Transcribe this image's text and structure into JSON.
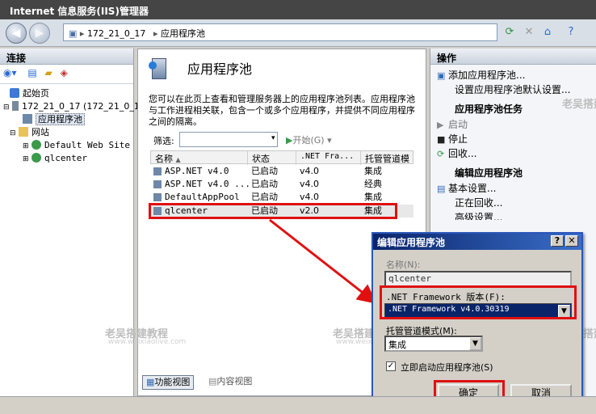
{
  "window": {
    "title": "Internet 信息服务(IIS)管理器"
  },
  "address": {
    "host": "172_21_0_17",
    "page": "应用程序池",
    "sep": "▸"
  },
  "left": {
    "header": "连接",
    "tree": {
      "start": "起始页",
      "server": "172_21_0_17 (172_21_0_1",
      "apppools": "应用程序池",
      "sites": "网站",
      "site1": "Default Web Site",
      "site2": "qlcenter"
    }
  },
  "center": {
    "title": "应用程序池",
    "description": "您可以在此页上查看和管理服务器上的应用程序池列表。应用程序池与工作进程相关联，包含一个或多个应用程序，并提供不同应用程序之间的隔离。",
    "filter_label": "筛选:",
    "start_label": "开始(G)",
    "columns": [
      "名称",
      "状态",
      ".NET Fra...",
      "托管管道模"
    ],
    "rows": [
      [
        "ASP.NET v4.0",
        "已启动",
        "v4.0",
        "集成"
      ],
      [
        "ASP.NET v4.0 ...",
        "已启动",
        "v4.0",
        "经典"
      ],
      [
        "DefaultAppPool",
        "已启动",
        "v4.0",
        "集成"
      ],
      [
        "qlcenter",
        "已启动",
        "v2.0",
        "集成"
      ]
    ],
    "tab_features": "功能视图",
    "tab_content": "内容视图"
  },
  "right": {
    "header": "操作",
    "add_pool": "添加应用程序池...",
    "set_defaults": "设置应用程序池默认设置...",
    "tasks_header": "应用程序池任务",
    "start": "启动",
    "stop": "停止",
    "recycle": "回收...",
    "edit_header": "编辑应用程序池",
    "basic": "基本设置...",
    "recycling": "正在回收...",
    "advanced": "高级设置..."
  },
  "dialog": {
    "title": "编辑应用程序池",
    "help": "?",
    "close": "✕",
    "name_label": "名称(N):",
    "name_value": "qlcenter",
    "fw_label": ".NET Framework 版本(F):",
    "fw_value": ".NET Framework v4.0.30319",
    "pipeline_label": "托管管道模式(M):",
    "pipeline_value": "集成",
    "autostart_label": "立即启动应用程序池(S)",
    "ok": "确定",
    "cancel": "取消"
  },
  "watermark": {
    "text": "老吴搭建教程",
    "sub": "www.weixiaolive.com"
  },
  "colors": {
    "highlight": "#e01010",
    "dialog_title": "#0a246a"
  }
}
